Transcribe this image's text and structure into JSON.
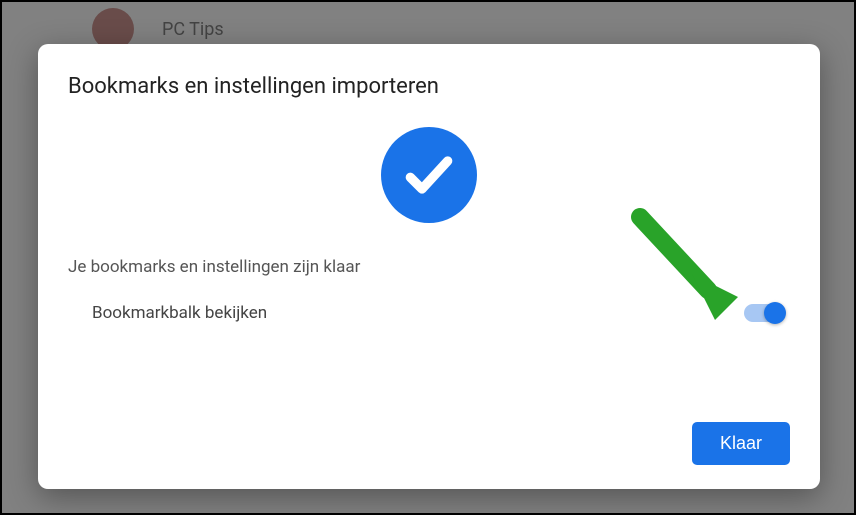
{
  "backdrop": {
    "user_name": "PC Tips"
  },
  "dialog": {
    "title": "Bookmarks en instellingen importeren",
    "status_text": "Je bookmarks en instellingen zijn klaar",
    "toggle_label": "Bookmarkbalk bekijken",
    "toggle_on": true,
    "done_button": "Klaar"
  },
  "colors": {
    "accent": "#1a73e8",
    "arrow": "#29a329"
  }
}
